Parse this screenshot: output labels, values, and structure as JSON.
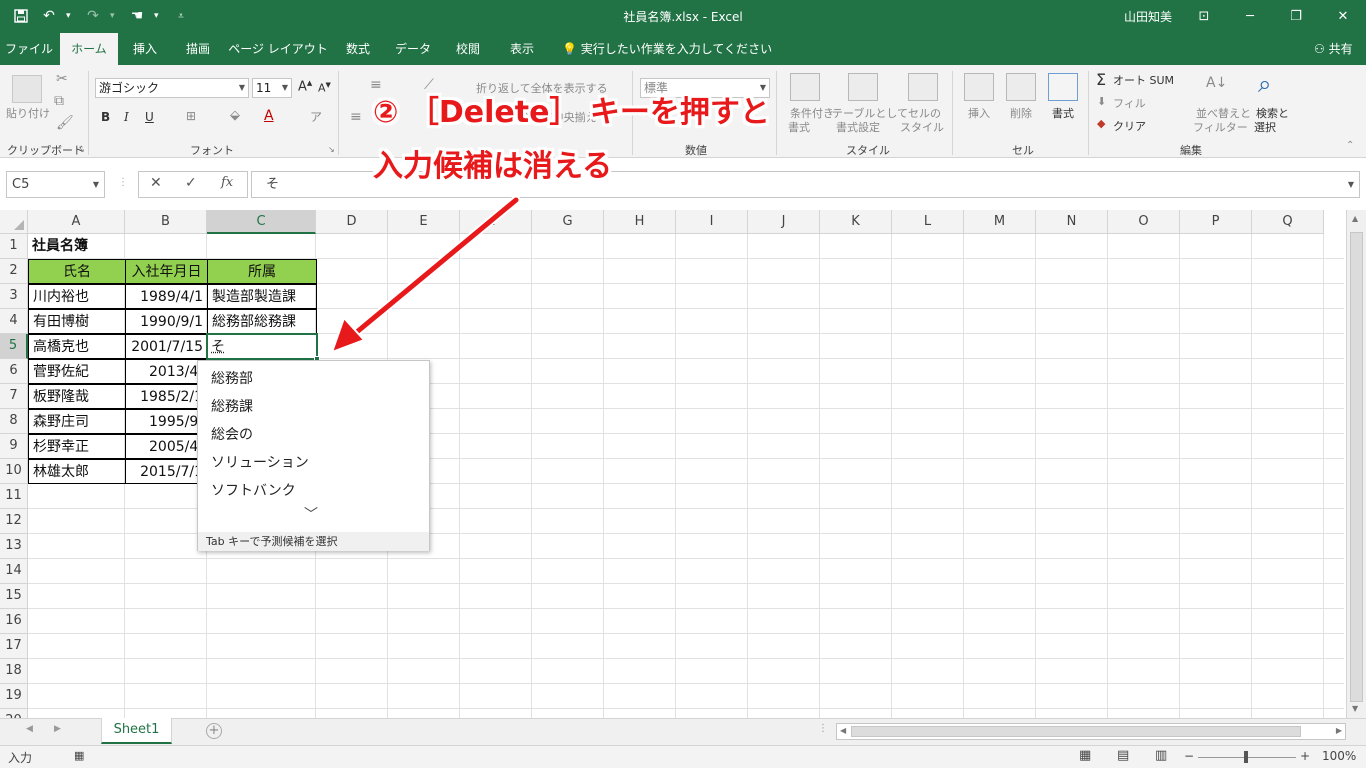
{
  "window": {
    "title": "社員名簿.xlsx  -  Excel",
    "user": "山田知美",
    "min_label": "─",
    "restore_label": "❐",
    "close_label": "✕",
    "ribbon_options_label": "⊡"
  },
  "quick_access": {
    "save_icon": "save-icon",
    "undo_icon": "undo-icon",
    "redo_icon": "redo-icon",
    "touch_icon": "touch-mode-icon",
    "customize_icon": "customize-icon"
  },
  "tabs": [
    "ファイル",
    "ホーム",
    "挿入",
    "描画",
    "ページ レイアウト",
    "数式",
    "データ",
    "校閲",
    "表示"
  ],
  "tell_me": "実行したい作業を入力してください",
  "share": "共有",
  "ribbon": {
    "clipboard": {
      "label": "クリップボード",
      "paste": "貼り付け"
    },
    "font": {
      "label": "フォント",
      "font_name": "游ゴシック",
      "font_size": "11",
      "bold": "B",
      "italic": "I",
      "underline": "U"
    },
    "alignment": {
      "wrap": "折り返して全体を表示する",
      "merge": "セルを結合して中央揃え"
    },
    "number": {
      "label": "数値",
      "format": "標準"
    },
    "styles": {
      "label": "スタイル",
      "conditional_1": "条件付き",
      "conditional_2": "書式",
      "table_1": "テーブルとして",
      "table_2": "書式設定",
      "cell_1": "セルの",
      "cell_2": "スタイル"
    },
    "cells": {
      "label": "セル",
      "insert": "挿入",
      "delete": "削除",
      "format": "書式"
    },
    "editing": {
      "label": "編集",
      "autosum": "オート SUM",
      "fill": "フィル",
      "clear": "クリア",
      "sort_1": "並べ替えと",
      "sort_2": "フィルター",
      "find_1": "検索と",
      "find_2": "選択"
    }
  },
  "formula_bar": {
    "name_box": "C5",
    "cancel": "✕",
    "enter": "✓",
    "fx": "fx",
    "content": "そ"
  },
  "columns": [
    "A",
    "B",
    "C",
    "D",
    "E",
    "F",
    "G",
    "H",
    "I",
    "J",
    "K",
    "L",
    "M",
    "N",
    "O",
    "P",
    "Q"
  ],
  "rows": [
    "1",
    "2",
    "3",
    "4",
    "5",
    "6",
    "7",
    "8",
    "9",
    "10",
    "11",
    "12",
    "13",
    "14",
    "15",
    "16",
    "17",
    "18",
    "19",
    "20"
  ],
  "sheet": {
    "title": "社員名簿",
    "headers": [
      "氏名",
      "入社年月日",
      "所属"
    ],
    "data": [
      {
        "name": "川内裕也",
        "date": "1989/4/1",
        "dept": "製造部製造課"
      },
      {
        "name": "有田博樹",
        "date": "1990/9/1",
        "dept": "総務部総務課"
      },
      {
        "name": "高橋克也",
        "date": "2001/7/15",
        "dept": "そ"
      },
      {
        "name": "菅野佐紀",
        "date": "2013/4/",
        "dept": ""
      },
      {
        "name": "板野隆哉",
        "date": "1985/2/1",
        "dept": ""
      },
      {
        "name": "森野庄司",
        "date": "1995/9/",
        "dept": ""
      },
      {
        "name": "杉野幸正",
        "date": "2005/4/",
        "dept": ""
      },
      {
        "name": "林雄太郎",
        "date": "2015/7/1",
        "dept": ""
      }
    ]
  },
  "autocomplete": {
    "items": [
      "総務部",
      "総務課",
      "総会の",
      "ソリューション",
      "ソフトバンク"
    ],
    "more": "﹀",
    "footer": "Tab キーで予測候補を選択"
  },
  "annotation": {
    "line1": "② ［Delete］ キーを押すと",
    "line2": "入力候補は消える",
    "color": "#e8191a"
  },
  "sheet_tabs": {
    "active": "Sheet1",
    "add": "+"
  },
  "status": {
    "mode": "入力",
    "zoom": "100%",
    "zoom_minus": "−",
    "zoom_plus": "+"
  },
  "colors": {
    "excel_green": "#217346",
    "header_fill": "#92d050"
  }
}
